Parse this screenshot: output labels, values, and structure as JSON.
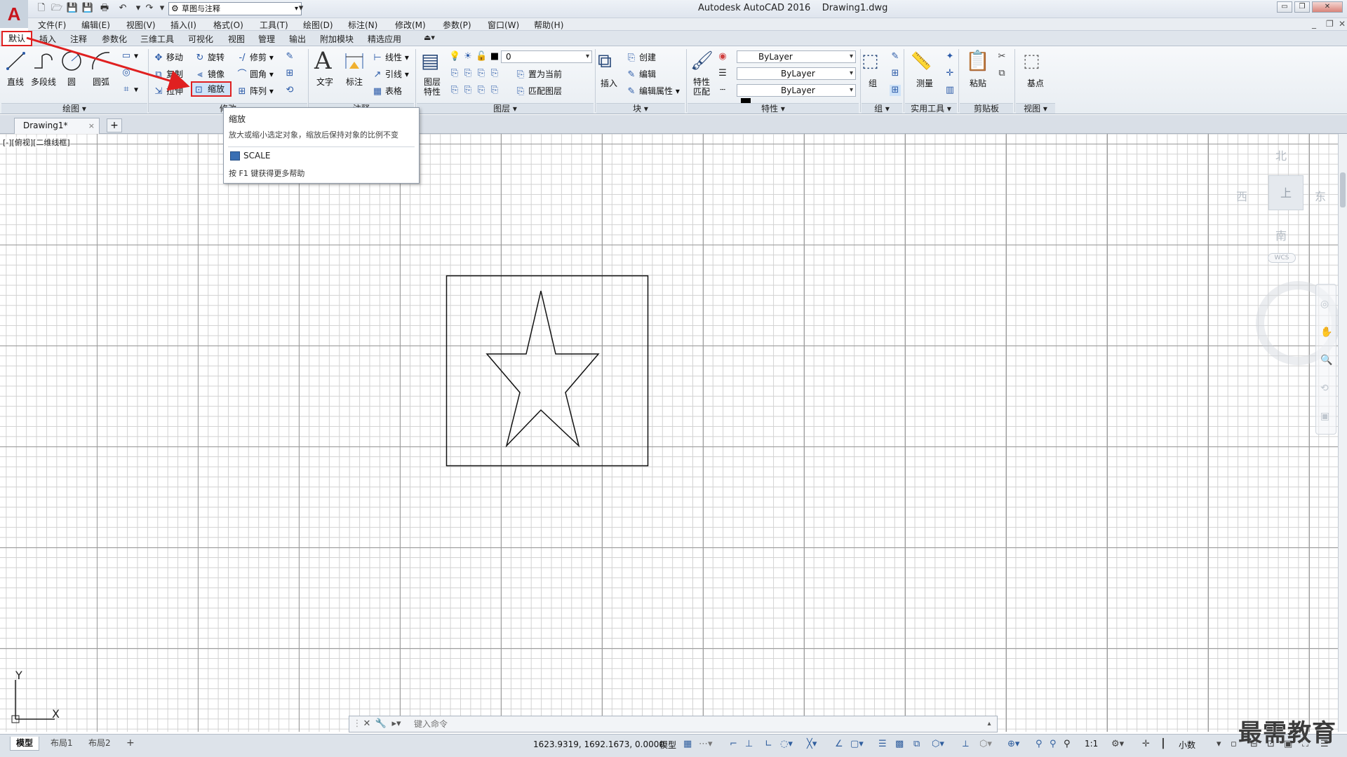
{
  "title_bar": {
    "title": "Autodesk AutoCAD 2016    Drawing1.dwg",
    "workspace": "草图与注释",
    "logo": "A"
  },
  "menu": [
    "文件(F)",
    "编辑(E)",
    "视图(V)",
    "插入(I)",
    "格式(O)",
    "工具(T)",
    "绘图(D)",
    "标注(N)",
    "修改(M)",
    "参数(P)",
    "窗口(W)",
    "帮助(H)"
  ],
  "ribbon_tabs": [
    "默认",
    "插入",
    "注释",
    "参数化",
    "三维工具",
    "可视化",
    "视图",
    "管理",
    "输出",
    "附加模块",
    "精选应用"
  ],
  "draw_panel": {
    "title": "绘图 ▾",
    "tools": [
      "直线",
      "多段线",
      "圆",
      "圆弧"
    ]
  },
  "modify_panel": {
    "title": "修改",
    "tools": [
      "移动",
      "旋转",
      "修剪",
      "复制",
      "镜像",
      "圆角",
      "拉伸",
      "缩放",
      "阵列"
    ]
  },
  "annotation_panel": {
    "title": "注释",
    "big_tools": [
      "文字",
      "标注"
    ],
    "tools": [
      "线性",
      "引线",
      "表格"
    ]
  },
  "layers_panel": {
    "title": "图层 ▾",
    "big_tool": "图层\n特性",
    "layer_value": "0",
    "tools": [
      "置为当前",
      "匹配图层"
    ]
  },
  "block_panel": {
    "title": "块 ▾",
    "big_tool": "插入",
    "tools": [
      "创建",
      "编辑",
      "编辑属性 ▾"
    ]
  },
  "properties_panel": {
    "title": "特性 ▾",
    "big_tool": "特性\n匹配",
    "color": "ByLayer",
    "linetype": "ByLayer",
    "lineweight": "ByLayer"
  },
  "group_panel": {
    "title": "组 ▾",
    "big_tool": "组"
  },
  "utilities_panel": {
    "title": "实用工具 ▾",
    "big_tool": "测量"
  },
  "clipboard_panel": {
    "title": "剪贴板",
    "big_tool": "粘贴"
  },
  "view_panel": {
    "title": "视图 ▾",
    "big_tool": "基点"
  },
  "doc_tab": {
    "name": "Drawing1*",
    "close": "×",
    "add": "+"
  },
  "viewport_label": "[-][俯视][二维线框]",
  "viewcube": {
    "north": "北",
    "south": "南",
    "east": "东",
    "west": "西",
    "top": "上",
    "wcs": "WCS"
  },
  "tooltip": {
    "title": "缩放",
    "description": "放大或缩小选定对象，缩放后保持对象的比例不变",
    "command": "SCALE",
    "help": "按 F1 键获得更多帮助"
  },
  "ucs": {
    "x": "X",
    "y": "Y"
  },
  "command_line": {
    "placeholder": "键入命令"
  },
  "status_bar": {
    "layouts": [
      "模型",
      "布局1",
      "布局2"
    ],
    "add_layout": "+",
    "coordinates": "1623.9319, 1692.1673, 0.0000",
    "model_label": "模型",
    "scale": "1:1",
    "units": "小数"
  },
  "watermark": "最需教育",
  "colors": {
    "highlight": "#e02020",
    "icon_blue": "#2a5aa8",
    "grid_major": "#9a9a9a",
    "grid_minor": "#d2d2d2"
  }
}
